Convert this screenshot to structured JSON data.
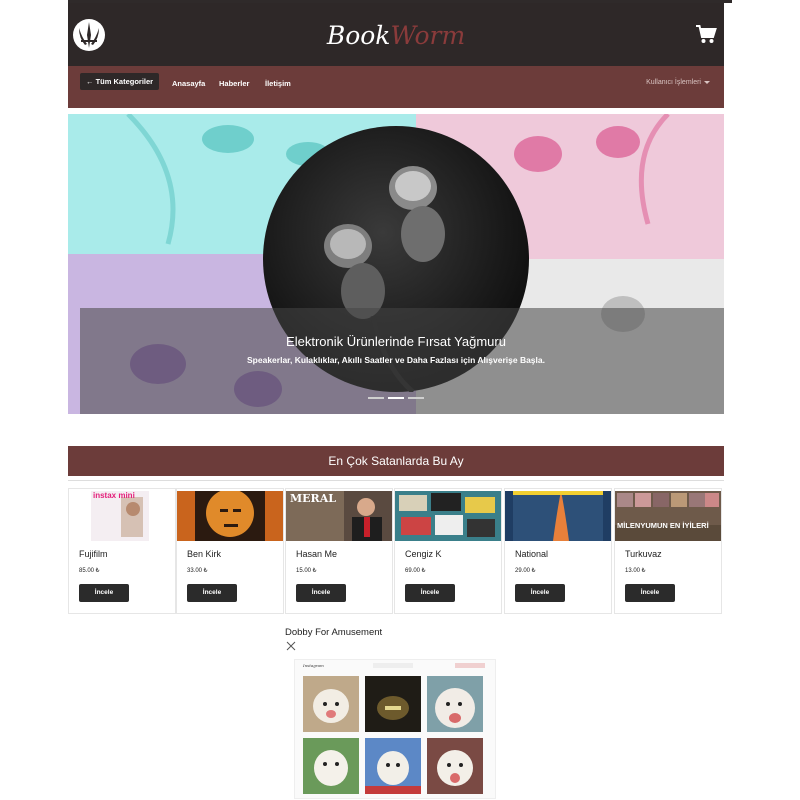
{
  "header": {
    "brand_part1": "Book",
    "brand_part2": "Worm",
    "logo_icon": "jedi-order-icon",
    "cart_icon": "shopping-cart-icon",
    "colors": {
      "header_bg": "#2e2828",
      "nav_bg": "#6c3c3a",
      "brand_accent": "#8a3b3b"
    }
  },
  "nav": {
    "all_categories": "← Tüm Kategoriler",
    "links": [
      "Anasayfa",
      "Haberler",
      "İletişim"
    ],
    "user_menu": "Kullanıcı İşlemleri"
  },
  "hero": {
    "title": "Elektronik Ürünlerinde Fırsat Yağmuru",
    "subtitle": "Speakerlar, Kulaklıklar, Akıllı Saatler ve Daha Fazlası için Alışverişe Başla.",
    "slide_count": 3,
    "active_slide": 2
  },
  "bestsellers": {
    "title": "En Çok Satanlarda Bu Ay",
    "button_label": "İncele",
    "products": [
      {
        "name": "Fujifilm",
        "price": "85.00 ₺"
      },
      {
        "name": "Ben Kirk",
        "price": "33.00 ₺"
      },
      {
        "name": "Hasan Me",
        "price": "15.00 ₺"
      },
      {
        "name": "Cengiz K",
        "price": "69.00 ₺"
      },
      {
        "name": "National",
        "price": "29.00 ₺"
      },
      {
        "name": "Turkuvaz",
        "price": "13.00 ₺"
      }
    ],
    "thumb_text": [
      "instax mini",
      "",
      "MERAL",
      "",
      "",
      "MİLENYUMUN EN İYİLERİ"
    ]
  },
  "ad": {
    "title": "Dobby For Amusement",
    "close_icon": "close-icon",
    "image_header": "Instagram"
  }
}
